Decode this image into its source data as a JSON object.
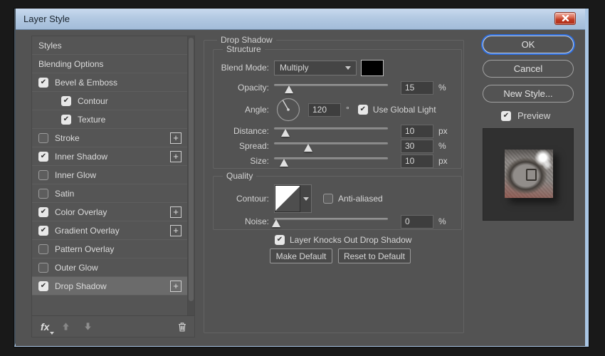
{
  "window": {
    "title": "Layer Style"
  },
  "icons": {
    "plus": "+",
    "check": "✔"
  },
  "colors": {
    "dialog_bg": "#535353",
    "titlebar": "#b3c9e2",
    "frame_blue": "#aac6e4",
    "close_red": "#c03a22",
    "ok_focus_ring": "#2f6fdf",
    "selected_row": "#6b6b6b",
    "swatch": "#000000"
  },
  "sidebar": {
    "items": [
      {
        "label": "Styles",
        "checkbox": false,
        "checked": false,
        "indent": false,
        "plus": false,
        "selected": false
      },
      {
        "label": "Blending Options",
        "checkbox": false,
        "checked": false,
        "indent": false,
        "plus": false,
        "selected": false
      },
      {
        "label": "Bevel & Emboss",
        "checkbox": true,
        "checked": true,
        "indent": false,
        "plus": false,
        "selected": false
      },
      {
        "label": "Contour",
        "checkbox": true,
        "checked": true,
        "indent": true,
        "plus": false,
        "selected": false
      },
      {
        "label": "Texture",
        "checkbox": true,
        "checked": true,
        "indent": true,
        "plus": false,
        "selected": false
      },
      {
        "label": "Stroke",
        "checkbox": true,
        "checked": false,
        "indent": false,
        "plus": true,
        "selected": false
      },
      {
        "label": "Inner Shadow",
        "checkbox": true,
        "checked": true,
        "indent": false,
        "plus": true,
        "selected": false
      },
      {
        "label": "Inner Glow",
        "checkbox": true,
        "checked": false,
        "indent": false,
        "plus": false,
        "selected": false
      },
      {
        "label": "Satin",
        "checkbox": true,
        "checked": false,
        "indent": false,
        "plus": false,
        "selected": false
      },
      {
        "label": "Color Overlay",
        "checkbox": true,
        "checked": true,
        "indent": false,
        "plus": true,
        "selected": false
      },
      {
        "label": "Gradient Overlay",
        "checkbox": true,
        "checked": true,
        "indent": false,
        "plus": true,
        "selected": false
      },
      {
        "label": "Pattern Overlay",
        "checkbox": true,
        "checked": false,
        "indent": false,
        "plus": false,
        "selected": false
      },
      {
        "label": "Outer Glow",
        "checkbox": true,
        "checked": false,
        "indent": false,
        "plus": false,
        "selected": false
      },
      {
        "label": "Drop Shadow",
        "checkbox": true,
        "checked": true,
        "indent": false,
        "plus": true,
        "selected": true
      }
    ]
  },
  "main": {
    "panel_title": "Drop Shadow",
    "structure": {
      "title": "Structure",
      "blend_mode": {
        "label": "Blend Mode:",
        "value": "Multiply"
      },
      "opacity": {
        "label": "Opacity:",
        "value": "15",
        "unit": "%",
        "percent": 13
      },
      "angle": {
        "label": "Angle:",
        "value": "120",
        "unit": "°",
        "global_light_label": "Use Global Light",
        "global_light_checked": true
      },
      "distance": {
        "label": "Distance:",
        "value": "10",
        "unit": "px",
        "percent": 10
      },
      "spread": {
        "label": "Spread:",
        "value": "30",
        "unit": "%",
        "percent": 30
      },
      "size": {
        "label": "Size:",
        "value": "10",
        "unit": "px",
        "percent": 9
      }
    },
    "quality": {
      "title": "Quality",
      "contour_label": "Contour:",
      "anti_aliased_label": "Anti-aliased",
      "anti_aliased_checked": false,
      "noise": {
        "label": "Noise:",
        "value": "0",
        "unit": "%",
        "percent": 2
      }
    },
    "knockout_label": "Layer Knocks Out Drop Shadow",
    "knockout_checked": true,
    "make_default_label": "Make Default",
    "reset_default_label": "Reset to Default"
  },
  "actions": {
    "ok": "OK",
    "cancel": "Cancel",
    "new_style": "New Style...",
    "preview_label": "Preview",
    "preview_checked": true
  }
}
